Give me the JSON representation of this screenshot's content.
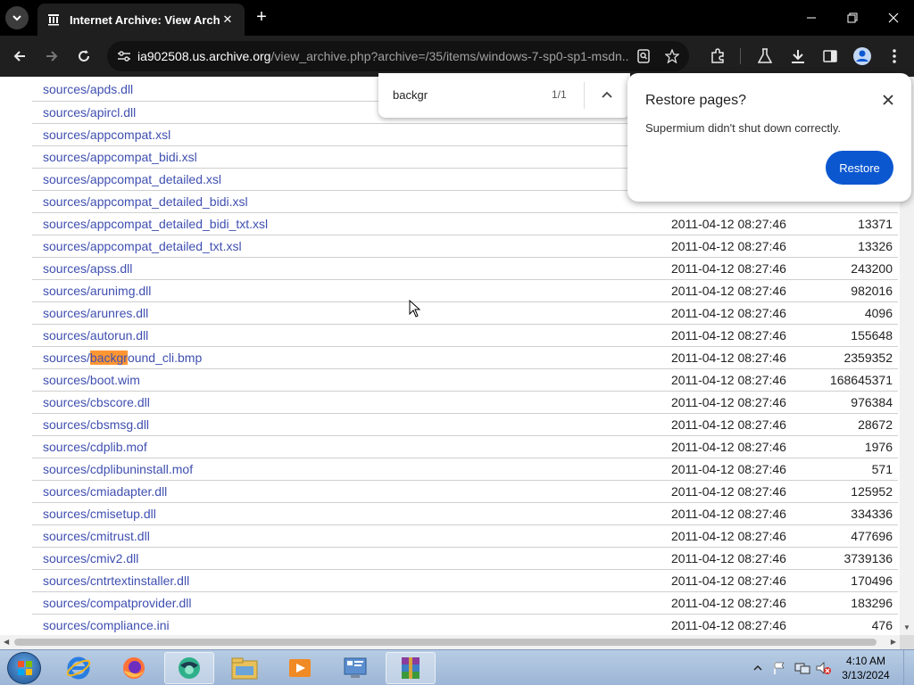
{
  "browser": {
    "tab_title": "Internet Archive: View Archive",
    "url_host": "ia902508.us.archive.org",
    "url_path": "/view_archive.php?archive=/35/items/windows-7-sp0-sp1-msdn..."
  },
  "find": {
    "query": "backgr",
    "count": "1/1"
  },
  "restore": {
    "title": "Restore pages?",
    "message": "Supermium didn't shut down correctly.",
    "button": "Restore"
  },
  "files": [
    {
      "name": "sources/apds.dll",
      "date": "",
      "size": ""
    },
    {
      "name": "sources/apircl.dll",
      "date": "",
      "size": ""
    },
    {
      "name": "sources/appcompat.xsl",
      "date": "",
      "size": ""
    },
    {
      "name": "sources/appcompat_bidi.xsl",
      "date": "",
      "size": ""
    },
    {
      "name": "sources/appcompat_detailed.xsl",
      "date": "",
      "size": ""
    },
    {
      "name": "sources/appcompat_detailed_bidi.xsl",
      "date": "",
      "size": ""
    },
    {
      "name": "sources/appcompat_detailed_bidi_txt.xsl",
      "date": "2011-04-12 08:27:46",
      "size": "13371"
    },
    {
      "name": "sources/appcompat_detailed_txt.xsl",
      "date": "2011-04-12 08:27:46",
      "size": "13326"
    },
    {
      "name": "sources/apss.dll",
      "date": "2011-04-12 08:27:46",
      "size": "243200"
    },
    {
      "name": "sources/arunimg.dll",
      "date": "2011-04-12 08:27:46",
      "size": "982016"
    },
    {
      "name": "sources/arunres.dll",
      "date": "2011-04-12 08:27:46",
      "size": "4096"
    },
    {
      "name": "sources/autorun.dll",
      "date": "2011-04-12 08:27:46",
      "size": "155648"
    },
    {
      "name": "sources/background_cli.bmp",
      "name_pre": "sources/",
      "name_hl": "backgr",
      "name_post": "ound_cli.bmp",
      "date": "2011-04-12 08:27:46",
      "size": "2359352"
    },
    {
      "name": "sources/boot.wim",
      "date": "2011-04-12 08:27:46",
      "size": "168645371"
    },
    {
      "name": "sources/cbscore.dll",
      "date": "2011-04-12 08:27:46",
      "size": "976384"
    },
    {
      "name": "sources/cbsmsg.dll",
      "date": "2011-04-12 08:27:46",
      "size": "28672"
    },
    {
      "name": "sources/cdplib.mof",
      "date": "2011-04-12 08:27:46",
      "size": "1976"
    },
    {
      "name": "sources/cdplibuninstall.mof",
      "date": "2011-04-12 08:27:46",
      "size": "571"
    },
    {
      "name": "sources/cmiadapter.dll",
      "date": "2011-04-12 08:27:46",
      "size": "125952"
    },
    {
      "name": "sources/cmisetup.dll",
      "date": "2011-04-12 08:27:46",
      "size": "334336"
    },
    {
      "name": "sources/cmitrust.dll",
      "date": "2011-04-12 08:27:46",
      "size": "477696"
    },
    {
      "name": "sources/cmiv2.dll",
      "date": "2011-04-12 08:27:46",
      "size": "3739136"
    },
    {
      "name": "sources/cntrtextinstaller.dll",
      "date": "2011-04-12 08:27:46",
      "size": "170496"
    },
    {
      "name": "sources/compatprovider.dll",
      "date": "2011-04-12 08:27:46",
      "size": "183296"
    },
    {
      "name": "sources/compliance.ini",
      "date": "2011-04-12 08:27:46",
      "size": "476"
    }
  ],
  "taskbar": {
    "time": "4:10 AM",
    "date": "3/13/2024",
    "apps": [
      "internet-explorer-icon",
      "firefox-icon",
      "supermium-icon",
      "file-explorer-icon",
      "media-player-icon",
      "control-panel-icon",
      "winrar-icon"
    ]
  },
  "colors": {
    "link": "#3f4fb0",
    "highlight": "#ff9632",
    "restore_button": "#0b57d0"
  }
}
